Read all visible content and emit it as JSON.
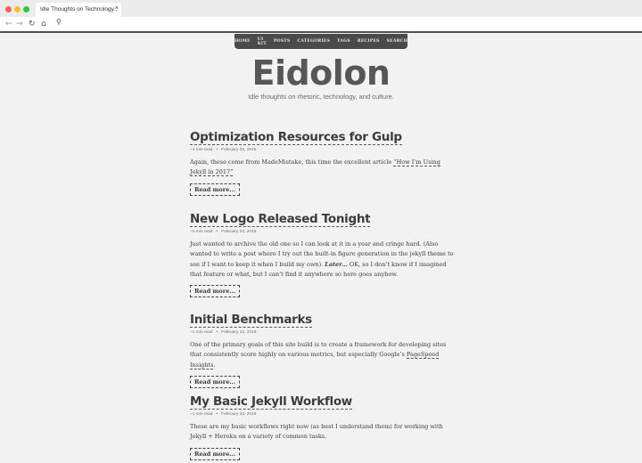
{
  "browser": {
    "tab_title": "Idle Thoughts on Technology...",
    "tab_close": "×",
    "back": "←",
    "forward": "→",
    "reload": "↻",
    "home": "⌂",
    "search_glyph": "⚲"
  },
  "nav": [
    "HOME",
    "UI KIT",
    "POSTS",
    "CATEGORIES",
    "TAGS",
    "RECIPES",
    "SEARCH"
  ],
  "site": {
    "logo": "Eidolon",
    "tagline": "Idle thoughts on rhetoric, technology, and culture."
  },
  "posts": [
    {
      "title": "Optimization Resources for Gulp",
      "readtime": "~1 min read",
      "dot": "•",
      "date": "February 25, 2018",
      "excerpt_a": "Again, these come from MadeMistake, this time the excellent article ",
      "excerpt_link": "“How I’m Using Jekyll in 2017”",
      "excerpt_b": "",
      "read_more": "Read more..."
    },
    {
      "title": "New Logo Released Tonight",
      "readtime": "~1 min read",
      "dot": "•",
      "date": "February 23, 2018",
      "excerpt_a": "Just wanted to archive the old one so I can look at it in a year and cringe hard. (Also wanted to write a post where I try out the built-in figure generation in the jekyll theme to see if I want to keep it when I build my own). ",
      "excerpt_em": "Later...",
      "excerpt_b": " OK, so I don’t know if I imagined that feature or what, but I can’t find it anywhere so here goes anyhow.",
      "read_more": "Read more..."
    },
    {
      "title": "Initial Benchmarks",
      "readtime": "~1 min read",
      "dot": "•",
      "date": "February 23, 2018",
      "excerpt_a": "One of the primary goals of this site build is to create a framework for developing sites that consistently score highly on various metrics, but especially Google’s ",
      "excerpt_link": "PageSpeed Insights",
      "excerpt_b": ".",
      "read_more": "Read more..."
    },
    {
      "title": "My Basic Jekyll Workflow",
      "readtime": "~1 min read",
      "dot": "•",
      "date": "February 23, 2018",
      "excerpt_a": "These are my basic workflows right now (as best I understand them) for working with Jekyll + Heroku on a variety of common tasks.",
      "read_more": "Read more..."
    }
  ]
}
